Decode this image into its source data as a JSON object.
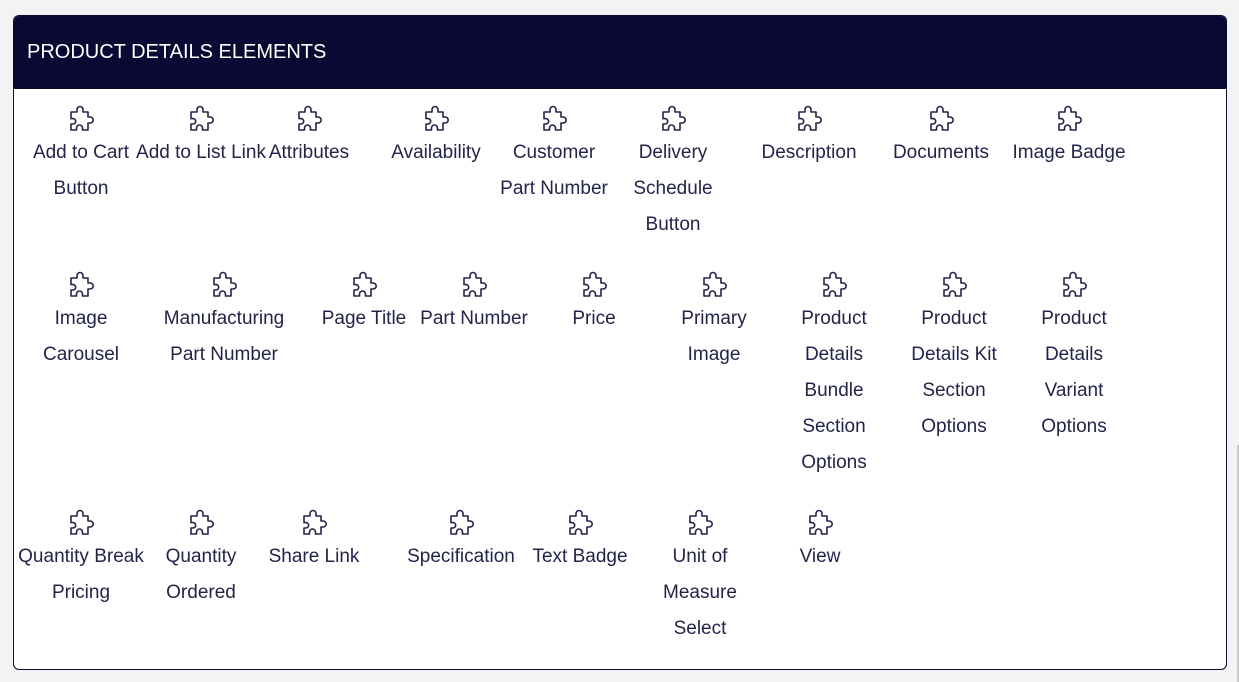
{
  "panel": {
    "title": "PRODUCT DETAILS ELEMENTS",
    "icon_name": "puzzle-piece-icon",
    "colors": {
      "header_bg": "#0a0933",
      "header_text": "#ffffff",
      "item_text": "#23244a",
      "border": "#0b0a33",
      "page_bg": "#f3f3f3"
    },
    "items": [
      {
        "label": "Add to Cart Button"
      },
      {
        "label": "Add to List Link"
      },
      {
        "label": "Attributes"
      },
      {
        "label": "Availability"
      },
      {
        "label": "Customer Part Number"
      },
      {
        "label": "Delivery Schedule Button"
      },
      {
        "label": "Description"
      },
      {
        "label": "Documents"
      },
      {
        "label": "Image Badge"
      },
      {
        "label": "Image Carousel"
      },
      {
        "label": "Manufacturing Part Number"
      },
      {
        "label": "Page Title"
      },
      {
        "label": "Part Number"
      },
      {
        "label": "Price"
      },
      {
        "label": "Primary Image"
      },
      {
        "label": "Product Details Bundle Section Options"
      },
      {
        "label": "Product Details Kit Section Options"
      },
      {
        "label": "Product Details Variant Options"
      },
      {
        "label": "Quantity Break Pricing"
      },
      {
        "label": "Quantity Ordered"
      },
      {
        "label": "Share Link"
      },
      {
        "label": "Specification"
      },
      {
        "label": "Text Badge"
      },
      {
        "label": "Unit of Measure Select"
      },
      {
        "label": "View"
      }
    ]
  }
}
